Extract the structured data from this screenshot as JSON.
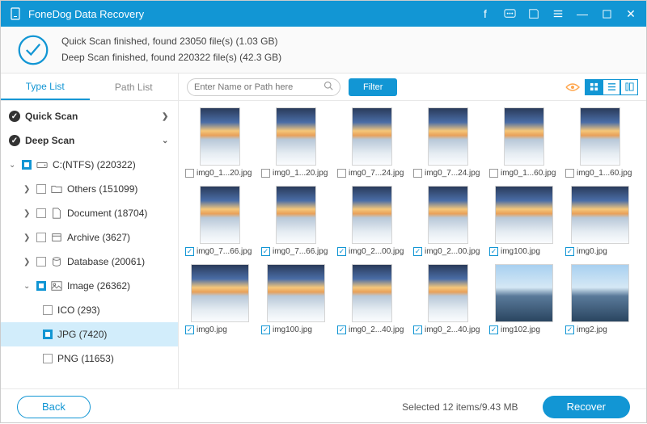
{
  "titlebar": {
    "title": "FoneDog Data Recovery"
  },
  "summary": {
    "line1": "Quick Scan finished, found 23050 file(s) (1.03 GB)",
    "line2": "Deep Scan finished, found 220322 file(s) (42.3 GB)"
  },
  "tabs": {
    "type_list": "Type List",
    "path_list": "Path List"
  },
  "tree": {
    "quick_scan": "Quick Scan",
    "deep_scan": "Deep Scan",
    "drive": "C:(NTFS) (220322)",
    "others": "Others (151099)",
    "document": "Document (18704)",
    "archive": "Archive (3627)",
    "database": "Database (20061)",
    "image": "Image (26362)",
    "ico": "ICO (293)",
    "jpg": "JPG (7420)",
    "png": "PNG (11653)"
  },
  "toolbar": {
    "search_placeholder": "Enter Name or Path here",
    "filter": "Filter"
  },
  "files": {
    "r1": [
      {
        "name": "img0_1...20.jpg",
        "checked": false,
        "portrait": true
      },
      {
        "name": "img0_1...20.jpg",
        "checked": false,
        "portrait": true
      },
      {
        "name": "img0_7...24.jpg",
        "checked": false,
        "portrait": true
      },
      {
        "name": "img0_7...24.jpg",
        "checked": false,
        "portrait": true
      },
      {
        "name": "img0_1...60.jpg",
        "checked": false,
        "portrait": true
      },
      {
        "name": "img0_1...60.jpg",
        "checked": false,
        "portrait": true
      }
    ],
    "r2": [
      {
        "name": "img0_7...66.jpg",
        "checked": true,
        "portrait": true
      },
      {
        "name": "img0_7...66.jpg",
        "checked": true,
        "portrait": true
      },
      {
        "name": "img0_2...00.jpg",
        "checked": true,
        "portrait": true
      },
      {
        "name": "img0_2...00.jpg",
        "checked": true,
        "portrait": true
      },
      {
        "name": "img100.jpg",
        "checked": true,
        "portrait": false
      },
      {
        "name": "img0.jpg",
        "checked": true,
        "portrait": false
      }
    ],
    "r3": [
      {
        "name": "img0.jpg",
        "checked": true,
        "portrait": false
      },
      {
        "name": "img100.jpg",
        "checked": true,
        "portrait": false
      },
      {
        "name": "img0_2...40.jpg",
        "checked": true,
        "portrait": true
      },
      {
        "name": "img0_2...40.jpg",
        "checked": true,
        "portrait": true
      },
      {
        "name": "img102.jpg",
        "checked": true,
        "portrait": false,
        "alt": true
      },
      {
        "name": "img2.jpg",
        "checked": true,
        "portrait": false,
        "alt": true
      }
    ]
  },
  "footer": {
    "back": "Back",
    "status": "Selected 12 items/9.43 MB",
    "recover": "Recover"
  }
}
